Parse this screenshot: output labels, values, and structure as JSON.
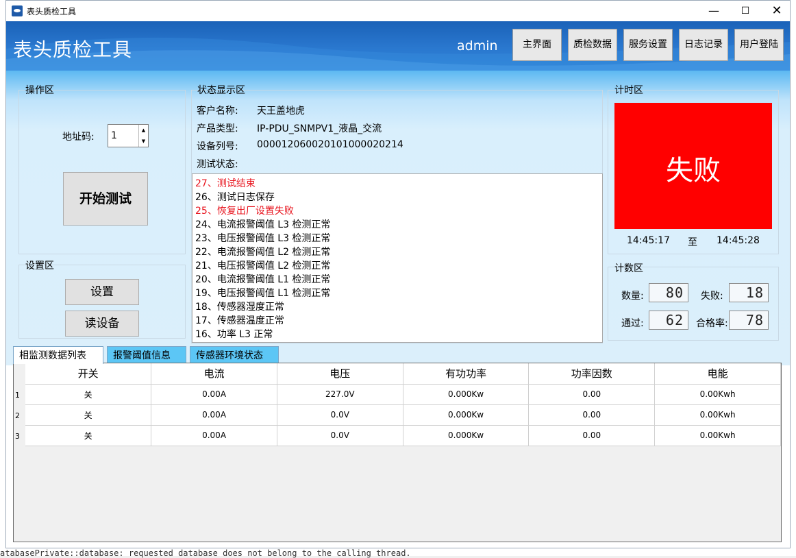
{
  "window": {
    "title": "表头质检工具",
    "min": "—",
    "max": "☐",
    "close": "✕"
  },
  "header": {
    "title": "表头质检工具",
    "user": "admin",
    "nav": [
      "主界面",
      "质检数据",
      "服务设置",
      "日志记录",
      "用户登陆"
    ]
  },
  "operation": {
    "label": "操作区",
    "address_label": "地址码:",
    "address_value": "1",
    "start_button": "开始测试"
  },
  "settings": {
    "label": "设置区",
    "set_button": "设置",
    "read_button": "读设备"
  },
  "status": {
    "label": "状态显示区",
    "customer_key": "客户名称:",
    "customer_val": "天王盖地虎",
    "product_key": "产品类型:",
    "product_val": "IP-PDU_SNMPV1_液晶_交流",
    "serial_key": "设备列号:",
    "serial_val": "000012060020101000020214",
    "test_key": "测试状态:",
    "log": [
      {
        "text": "27、测试结束",
        "error": true
      },
      {
        "text": "26、测试日志保存",
        "error": false
      },
      {
        "text": "25、恢复出厂设置失败",
        "error": true
      },
      {
        "text": "24、电流报警阈值 L3 检测正常",
        "error": false
      },
      {
        "text": "23、电压报警阈值 L3 检测正常",
        "error": false
      },
      {
        "text": "22、电流报警阈值 L2 检测正常",
        "error": false
      },
      {
        "text": "21、电压报警阈值 L2 检测正常",
        "error": false
      },
      {
        "text": "20、电流报警阈值 L1 检测正常",
        "error": false
      },
      {
        "text": "19、电压报警阈值 L1 检测正常",
        "error": false
      },
      {
        "text": "18、传感器湿度正常",
        "error": false
      },
      {
        "text": "17、传感器温度正常",
        "error": false
      },
      {
        "text": "16、功率 L3 正常",
        "error": false
      }
    ]
  },
  "timer": {
    "label": "计时区",
    "result": "失败",
    "result_color": "#ff0000",
    "start_time": "14:45:17",
    "to": "至",
    "end_time": "14:45:28"
  },
  "counter": {
    "label": "计数区",
    "qty_key": "数量:",
    "qty_val": "80",
    "fail_key": "失败:",
    "fail_val": "18",
    "pass_key": "通过:",
    "pass_val": "62",
    "rate_key": "合格率:",
    "rate_val": "78"
  },
  "tabs": [
    "相监测数据列表",
    "报警阈值信息",
    "传感器环境状态"
  ],
  "table": {
    "headers": [
      "开关",
      "电流",
      "电压",
      "有功功率",
      "功率因数",
      "电能"
    ],
    "rows": [
      {
        "n": "1",
        "cells": [
          "关",
          "0.00A",
          "227.0V",
          "0.000Kw",
          "0.00",
          "0.00Kwh"
        ]
      },
      {
        "n": "2",
        "cells": [
          "关",
          "0.00A",
          "0.0V",
          "0.000Kw",
          "0.00",
          "0.00Kwh"
        ]
      },
      {
        "n": "3",
        "cells": [
          "关",
          "0.00A",
          "0.0V",
          "0.000Kw",
          "0.00",
          "0.00Kwh"
        ]
      }
    ]
  },
  "background_terminal": "atabasePrivate::database: requested database does not belong to the calling thread."
}
